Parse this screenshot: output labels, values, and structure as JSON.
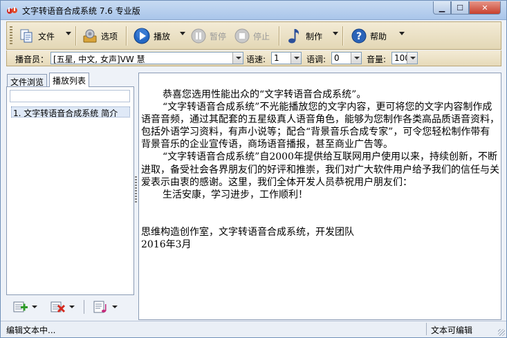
{
  "window": {
    "title": "文字转语音合成系统 7.6 专业版",
    "controls": {
      "minimize": "▁",
      "maximize": "☐",
      "close": "✕"
    }
  },
  "toolbar": {
    "file": "文件",
    "options": "选项",
    "play": "播放",
    "pause": "暂停",
    "stop": "停止",
    "produce": "制作",
    "help": "帮助"
  },
  "settings": {
    "announcer_label": "播音员：",
    "announcer_value": "[五星, 中文, 女声]VW 慧",
    "speed_label": "语速:",
    "speed_value": "1",
    "pitch_label": "语调:",
    "pitch_value": "0",
    "volume_label": "音量:",
    "volume_value": "100"
  },
  "left_panel": {
    "tabs": [
      {
        "label": "文件浏览",
        "active": false
      },
      {
        "label": "播放列表",
        "active": true
      }
    ],
    "items": [
      "1. 文字转语音合成系统 简介"
    ]
  },
  "editor": {
    "lines": [
      {
        "text": "恭喜您选用性能出众的“文字转语音合成系统”。",
        "indent": true
      },
      {
        "text": "“文字转语音合成系统”不光能播放您的文字内容，更可将您的文字内容制作成语音音频，通过其配套的五星级真人语音角色，能够为您制作各类高品质语音资料，包括外语学习资料，有声小说等；配合“背景音乐合成专家”，可令您轻松制作带有背景音乐的企业宣传语，商场语音播报，甚至商业广告等。",
        "indent": true
      },
      {
        "text": "“文字转语音合成系统”自2000年提供给互联网用户使用以来，持续创新，不断进取，备受社会各界朋友们的好评和推崇，我们对广大软件用户给予我们的信任与关爱表示由衷的感谢。这里，我们全体开发人员恭祝用户朋友们：",
        "indent": true
      },
      {
        "text": "生活安康，学习进步，工作顺利！",
        "indent": true
      },
      {
        "text": "",
        "indent": false
      },
      {
        "text": "",
        "indent": false
      },
      {
        "text": "思维构造创作室，文字转语音合成系统，开发团队",
        "indent": false
      },
      {
        "text": "2016年3月",
        "indent": false
      }
    ]
  },
  "status": {
    "left": "编辑文本中...",
    "right": "文本可编辑"
  },
  "colors": {
    "toolbar_bg": "#e9dfc2",
    "title_bg": "#b9d1ef",
    "play_icon": "#1f5fb8",
    "help_icon": "#2a63b8"
  }
}
